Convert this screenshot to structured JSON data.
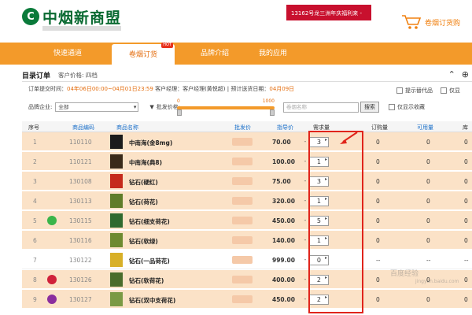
{
  "header": {
    "logo_mark": "C",
    "logo_text": "中烟新商盟",
    "promo_text": "13162号龙三洲年庆福利来 -",
    "cart_label": "卷烟订货购"
  },
  "nav": {
    "items": [
      {
        "label": "快速通道"
      },
      {
        "label": "卷烟订货",
        "hot": "HOT"
      },
      {
        "label": "品牌介绍"
      },
      {
        "label": "我的应用"
      }
    ]
  },
  "page": {
    "title": "目录订单",
    "subtitle": "客户价格: 四档",
    "order_time_label": "订单提交时间：",
    "order_time_value": "04年06日00:00~04月01日23:59",
    "manager": "客户经理：客户经理(黄悦超) | 预计送货日期：",
    "delivery_date": "04月09日",
    "checkbox_alt": "提示替代品",
    "checkbox_alt2": "仅显"
  },
  "filter": {
    "brand_label": "品牌企业:",
    "brand_value": "全部",
    "price_label": "批发价格:",
    "price_min": "0",
    "price_max": "1000",
    "search_placeholder": "卷烟名称",
    "search_button": "搜索",
    "only_fav": "仅显示收藏"
  },
  "table": {
    "headers": [
      "序号",
      "商品编码",
      "商品名称",
      "批发价",
      "指导价",
      "需求量",
      "订购量",
      "可用量",
      "库存"
    ],
    "rows": [
      {
        "idx": "1",
        "code": "110110",
        "name": "中南海(金8mg)",
        "guide": "70.00",
        "qty": "3",
        "order": "0",
        "avail": "0",
        "stock": "0",
        "badge": ""
      },
      {
        "idx": "2",
        "code": "110121",
        "name": "中南海(典8)",
        "guide": "100.00",
        "qty": "1",
        "order": "0",
        "avail": "0",
        "stock": "0",
        "badge": ""
      },
      {
        "idx": "3",
        "code": "130108",
        "name": "钻石(硬红)",
        "guide": "75.00",
        "qty": "3",
        "order": "0",
        "avail": "0",
        "stock": "0",
        "badge": ""
      },
      {
        "idx": "4",
        "code": "130113",
        "name": "钻石(荷花)",
        "guide": "320.00",
        "qty": "1",
        "order": "0",
        "avail": "0",
        "stock": "0",
        "badge": ""
      },
      {
        "idx": "5",
        "code": "130115",
        "name": "钻石(细支荷花)",
        "guide": "450.00",
        "qty": "5",
        "order": "0",
        "avail": "0",
        "stock": "0",
        "badge": "green"
      },
      {
        "idx": "6",
        "code": "130116",
        "name": "钻石(软绿)",
        "guide": "140.00",
        "qty": "1",
        "order": "0",
        "avail": "0",
        "stock": "0",
        "badge": ""
      },
      {
        "idx": "7",
        "code": "130122",
        "name": "钻石(一品荷花)",
        "guide": "999.00",
        "qty": "0",
        "order": "--",
        "avail": "--",
        "stock": "--",
        "badge": ""
      },
      {
        "idx": "8",
        "code": "130126",
        "name": "钻石(软荷花)",
        "guide": "400.00",
        "qty": "2",
        "order": "0",
        "avail": "0",
        "stock": "0",
        "badge": "red"
      },
      {
        "idx": "9",
        "code": "130127",
        "name": "钻石(双中支荷花)",
        "guide": "450.00",
        "qty": "2",
        "order": "0",
        "avail": "0",
        "stock": "0",
        "badge": "purple"
      }
    ]
  },
  "watermark": "百度经验",
  "watermark_url": "jingyan.baidu.com",
  "colors": {
    "nav": "#f39a2a",
    "accent": "#e46d0e",
    "row": "#fbe2c7",
    "highlight": "#e0241b"
  }
}
